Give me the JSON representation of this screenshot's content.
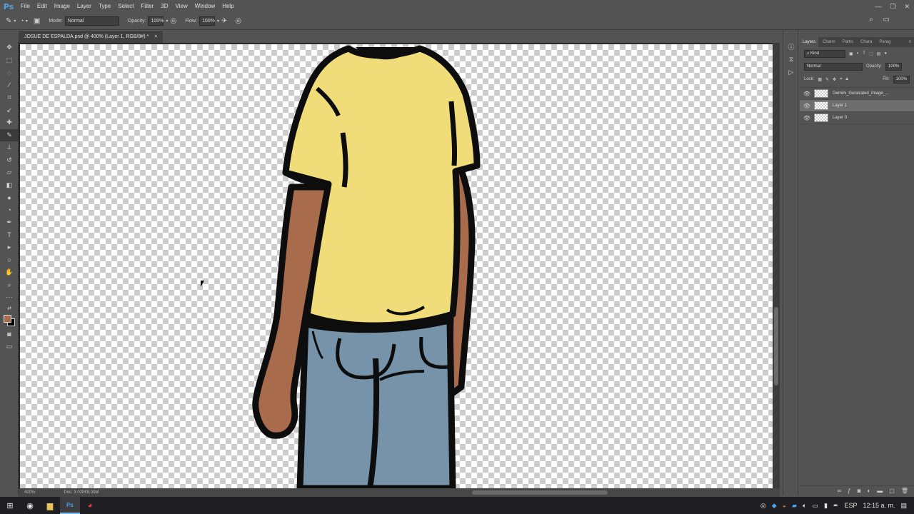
{
  "app": {
    "logo": "Ps"
  },
  "menu": [
    "File",
    "Edit",
    "Image",
    "Layer",
    "Type",
    "Select",
    "Filter",
    "3D",
    "View",
    "Window",
    "Help"
  ],
  "window_controls": {
    "minimize": "—",
    "restore": "❐",
    "close": "✕"
  },
  "options_bar": {
    "mode_label": "Mode:",
    "mode_value": "Normal",
    "opacity_label": "Opacity:",
    "opacity_value": "100%",
    "flow_label": "Flow:",
    "flow_value": "100%"
  },
  "document": {
    "tab_title": "JOSUE DE ESPALDA.psd @ 400% (Layer 1, RGB/8#) *",
    "close_glyph": "×"
  },
  "status": {
    "zoom": "400%",
    "doc_size": "Doc: 3.02M/9.00M"
  },
  "panel": {
    "tabs": [
      "Layers",
      "Chann",
      "Paths",
      "Chara",
      "Parag"
    ],
    "kind_label": "⌕ Kind",
    "blend_mode": "Normal",
    "opacity_label": "Opacity:",
    "opacity_value": "100%",
    "lock_label": "Lock:",
    "fill_label": "Fill:",
    "fill_value": "100%",
    "layers": [
      {
        "name": "Gemini_Generated_Image_...",
        "selected": false
      },
      {
        "name": "Layer 1",
        "selected": true
      },
      {
        "name": "Layer 0",
        "selected": false
      }
    ]
  },
  "colors": {
    "shirt": "#f0dc78",
    "skin": "#a86b4c",
    "jeans": "#7693a9",
    "outline": "#0d0d0d",
    "foreground_swatch": "#a86b4c"
  },
  "taskbar": {
    "language": "ESP",
    "time": "12:15 a. m."
  }
}
